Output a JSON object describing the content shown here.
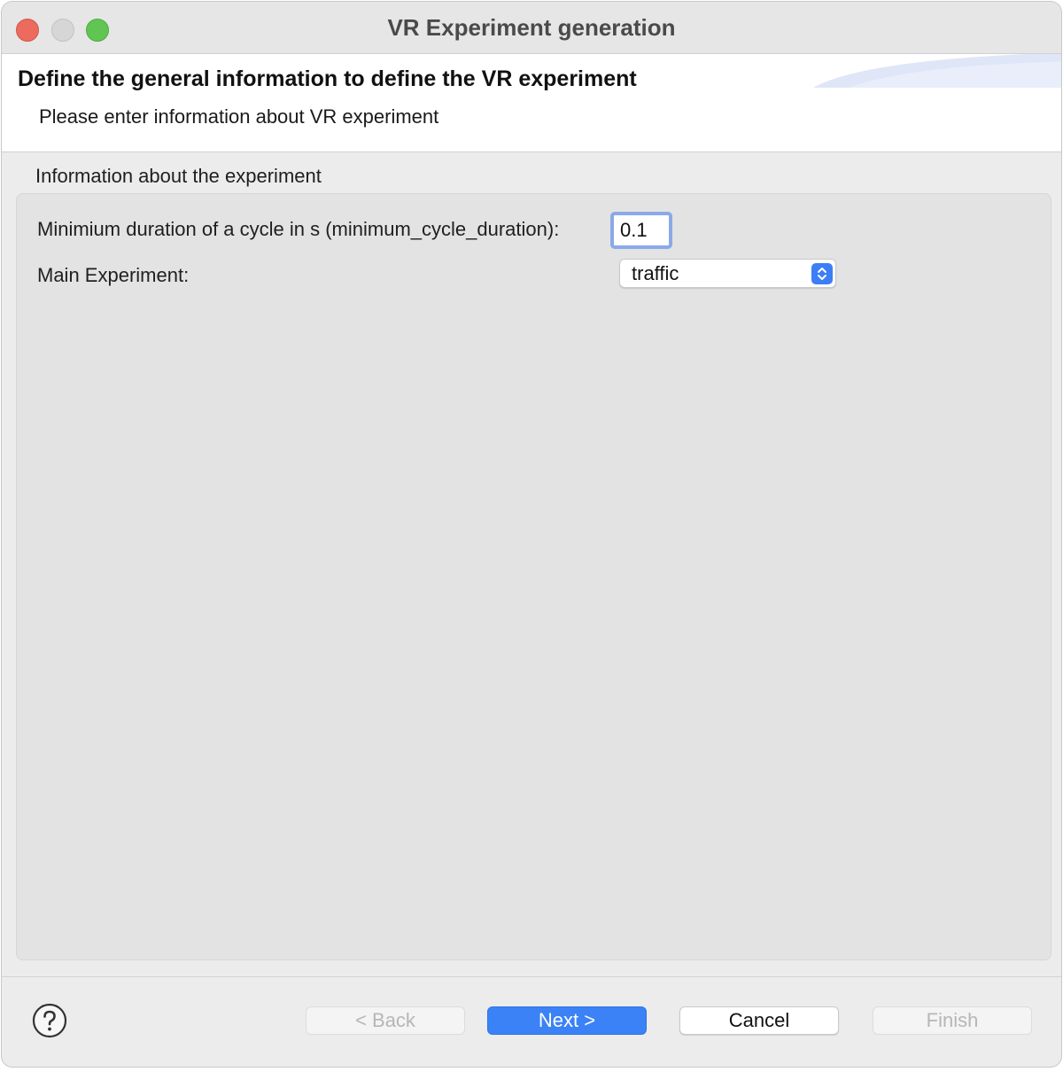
{
  "window": {
    "title": "VR Experiment generation"
  },
  "header": {
    "title": "Define the general information to define the VR experiment",
    "description": "Please enter information about VR experiment"
  },
  "group": {
    "label": "Information about the experiment"
  },
  "fields": {
    "cycle_label": "Minimium duration of a cycle in s (minimum_cycle_duration):",
    "cycle_value": "0.1",
    "main_experiment_label": "Main Experiment:",
    "main_experiment_value": "traffic"
  },
  "buttons": {
    "back": "< Back",
    "next": "Next >",
    "cancel": "Cancel",
    "finish": "Finish"
  },
  "icons": {
    "help": "help-icon",
    "select_arrows": "chevron-up-down-icon"
  },
  "colors": {
    "accent": "#3b82f6",
    "close": "#ec6a5e",
    "maximize": "#61c554"
  }
}
